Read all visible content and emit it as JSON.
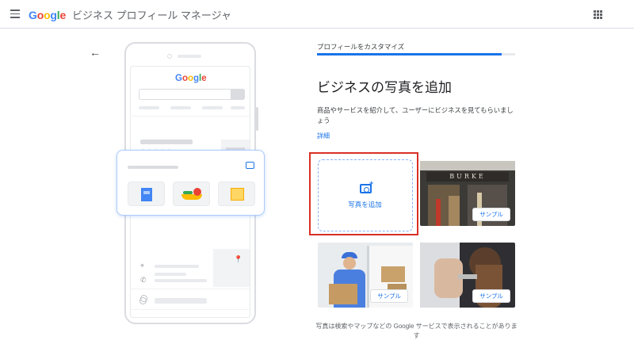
{
  "header": {
    "logo": [
      {
        "ch": "G",
        "color": "#4285F4"
      },
      {
        "ch": "o",
        "color": "#EA4335"
      },
      {
        "ch": "o",
        "color": "#FBBC05"
      },
      {
        "ch": "g",
        "color": "#4285F4"
      },
      {
        "ch": "l",
        "color": "#34A853"
      },
      {
        "ch": "e",
        "color": "#EA4335"
      }
    ],
    "product_name": "ビジネス プロフィール マネージャ",
    "menu_icon": "hamburger-menu-icon",
    "apps_icon": "apps-grid-icon"
  },
  "preview": {
    "back_icon": "arrow-back-icon",
    "mini_logo": "Google"
  },
  "panel": {
    "step_label": "プロフィールをカスタマイズ",
    "progress_fraction": 0.93,
    "title": "ビジネスの写真を追加",
    "description": "商品やサービスを紹介して、ユーザーにビジネスを見てもらいましょう",
    "details_link": "詳細",
    "add_photo_label": "写真を追加",
    "samples": [
      {
        "button": "サンプル",
        "sign": "BURKE",
        "subject": "storefront"
      },
      {
        "button": "サンプル",
        "subject": "delivery"
      },
      {
        "button": "サンプル",
        "subject": "hair-salon"
      }
    ],
    "footer_note": "写真は検索やマップなどの Google サービスで表示されることがあります"
  },
  "colors": {
    "accent": "#1a73e8",
    "highlight": "#d93025"
  }
}
